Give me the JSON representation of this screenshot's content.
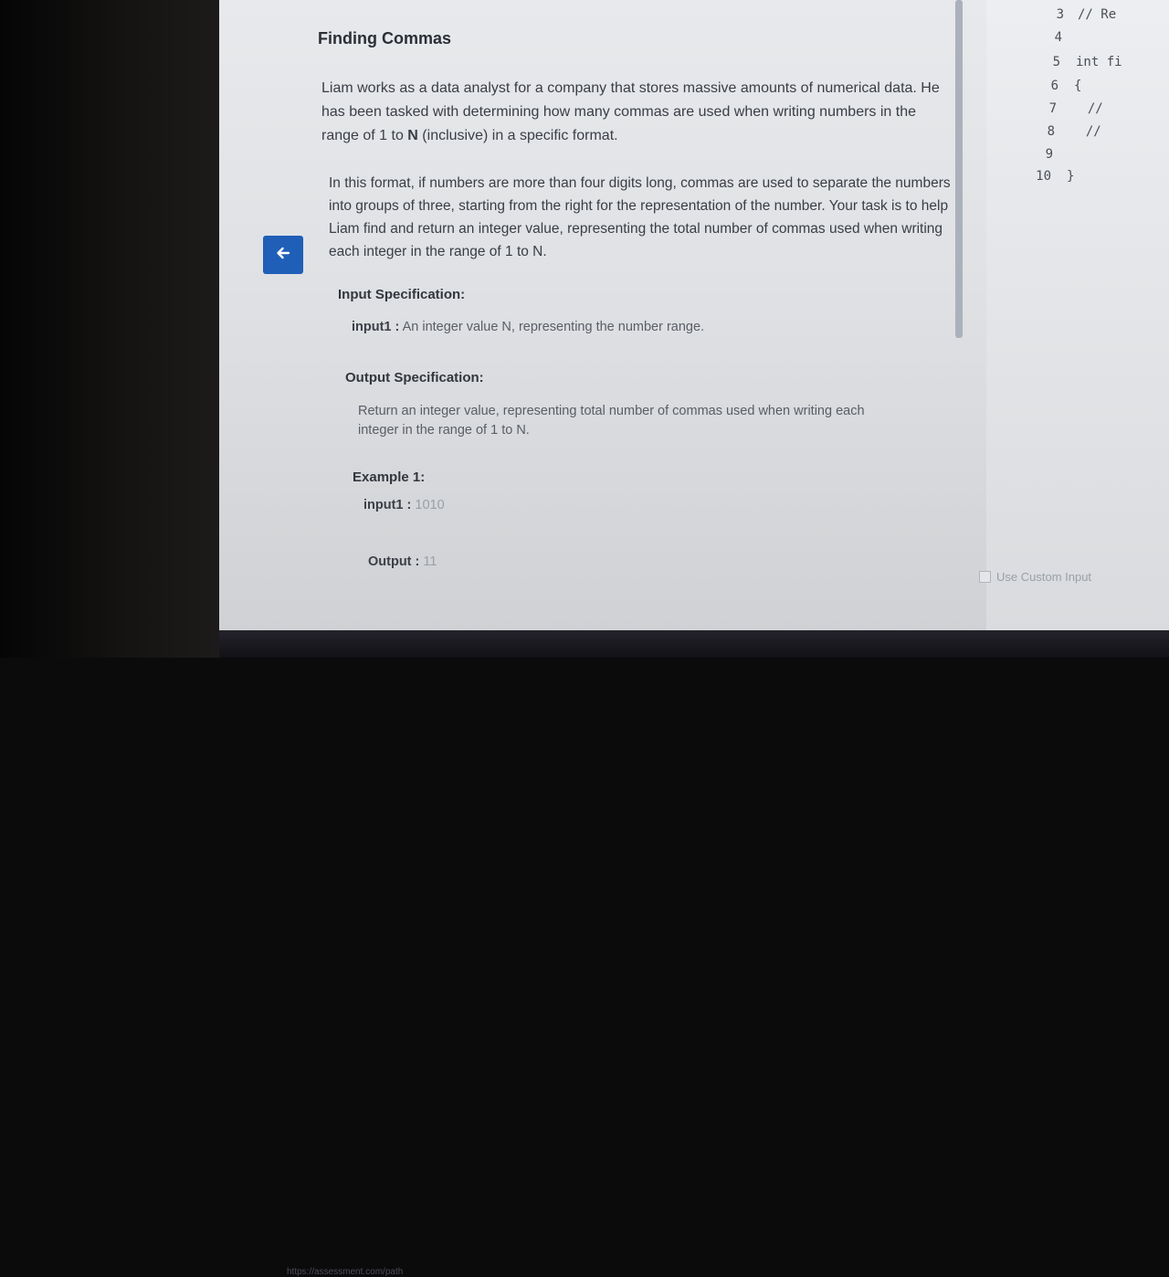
{
  "problem": {
    "title": "Finding Commas",
    "para1_pre": "Liam works as a data analyst for a company that stores massive amounts of numerical data. He has been tasked with determining how many commas are used when writing numbers in the range of 1 to ",
    "para1_bold": "N",
    "para1_post": " (inclusive) in a specific format.",
    "para2": "In this format, if numbers are more than four digits long, commas are used to separate the numbers into groups of three, starting from the right for the representation of the number. Your task is to help Liam find and return an integer value, representing the total number of commas used when writing each integer in the range of 1 to N.",
    "input_spec_heading": "Input Specification:",
    "input1_label": "input1 :",
    "input1_desc": "An integer value N, representing the number range.",
    "output_spec_heading": "Output Specification:",
    "output_desc": "Return an integer value, representing total number of commas used when writing each integer in the range of 1 to N.",
    "example_heading": "Example 1:",
    "example_input_label": "input1 :",
    "example_input_value": "1010",
    "example_output_label": "Output :",
    "example_output_value": "11"
  },
  "back_button": {
    "icon": "arrow-left-icon",
    "color": "#1f5fb8"
  },
  "editor": {
    "lines": [
      {
        "num": "3",
        "code": "// Re"
      },
      {
        "num": "4",
        "code": ""
      },
      {
        "num": "5",
        "code": "int fi"
      },
      {
        "num": "6",
        "code": "{"
      },
      {
        "num": "7",
        "code": "  //"
      },
      {
        "num": "8",
        "code": "  //"
      },
      {
        "num": "9",
        "code": ""
      },
      {
        "num": "10",
        "code": "}"
      }
    ],
    "custom_input_label": "Use Custom Input"
  },
  "status_bar": {
    "url": "https://assessment.com/path"
  }
}
